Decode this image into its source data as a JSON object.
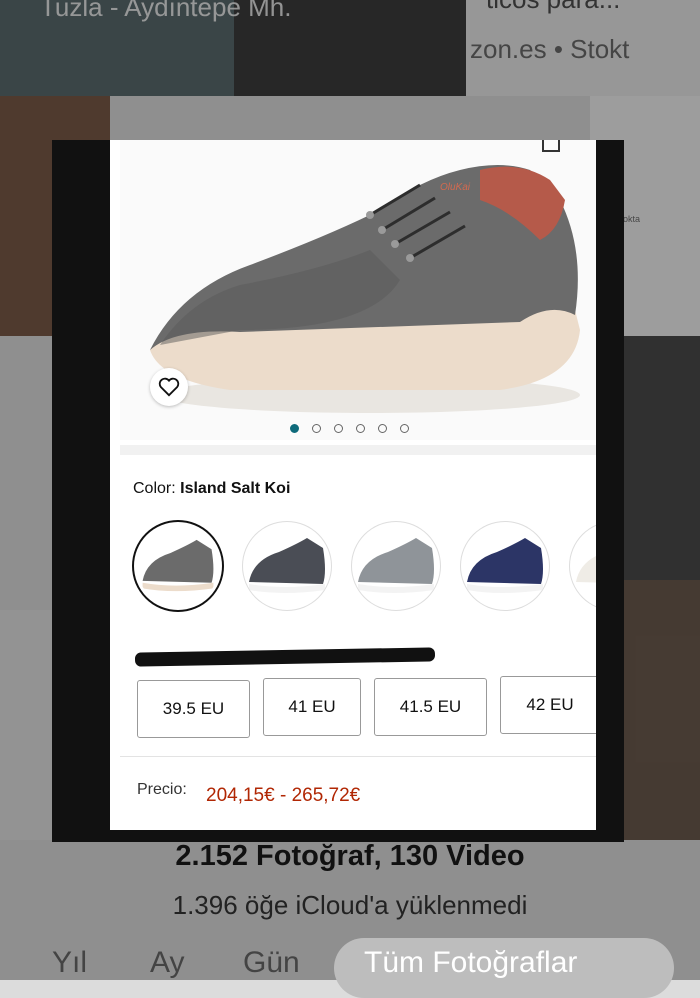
{
  "background": {
    "top_left_text": "Tuzla - Aydıntepe Mh.",
    "top_mid_text": "ticos para...",
    "top_right_text": "zon.es • Stokt",
    "side_snippet": "ra... stokta"
  },
  "product": {
    "color_label": "Color:",
    "color_value": "Island Salt Koi",
    "image_dots": 6,
    "active_dot": 0,
    "sizes": [
      "39.5 EU",
      "41 EU",
      "41.5 EU",
      "42 EU"
    ],
    "price_label": "Precio:",
    "price_value": "204,15€ - 265,72€"
  },
  "footer": {
    "title": "2.152 Fotoğraf, 130 Video",
    "subtitle": "1.396 öğe iCloud'a yüklenmedi"
  },
  "tabs": [
    "Yıl",
    "Ay",
    "Gün",
    "Tüm Fotoğraflar"
  ],
  "colors": {
    "accent_dot": "#0f6a7a",
    "price": "#b12704",
    "shoe_gray": "#6b6b6b",
    "shoe_navy": "#2c3566"
  }
}
